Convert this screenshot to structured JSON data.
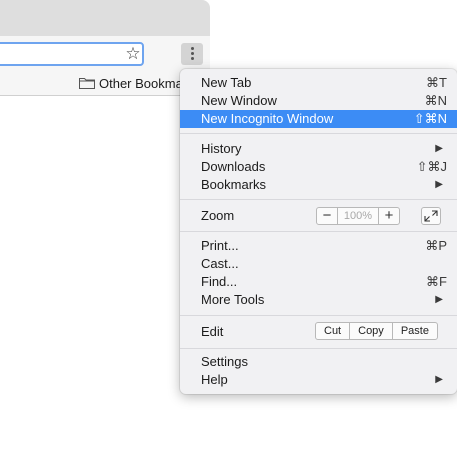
{
  "bookmarks_bar": {
    "other_bookmarks_label": "Other Bookmarks"
  },
  "toolbar": {
    "star_icon": "star-icon",
    "menu_icon": "three-dot-menu-icon"
  },
  "menu": {
    "accent_color": "#3c8cf5",
    "new_tab": {
      "label": "New Tab",
      "shortcut": "⌘T"
    },
    "new_window": {
      "label": "New Window",
      "shortcut": "⌘N"
    },
    "new_incognito": {
      "label": "New Incognito Window",
      "shortcut": "⇧⌘N"
    },
    "history": {
      "label": "History",
      "arrow": "▶"
    },
    "downloads": {
      "label": "Downloads",
      "shortcut": "⇧⌘J"
    },
    "bookmarks": {
      "label": "Bookmarks",
      "arrow": "▶"
    },
    "zoom": {
      "label": "Zoom",
      "minus": "−",
      "value": "100%",
      "plus": "+"
    },
    "print": {
      "label": "Print...",
      "shortcut": "⌘P"
    },
    "cast": {
      "label": "Cast..."
    },
    "find": {
      "label": "Find...",
      "shortcut": "⌘F"
    },
    "more_tools": {
      "label": "More Tools",
      "arrow": "▶"
    },
    "edit": {
      "label": "Edit",
      "cut": "Cut",
      "copy": "Copy",
      "paste": "Paste"
    },
    "settings": {
      "label": "Settings"
    },
    "help": {
      "label": "Help",
      "arrow": "▶"
    }
  }
}
